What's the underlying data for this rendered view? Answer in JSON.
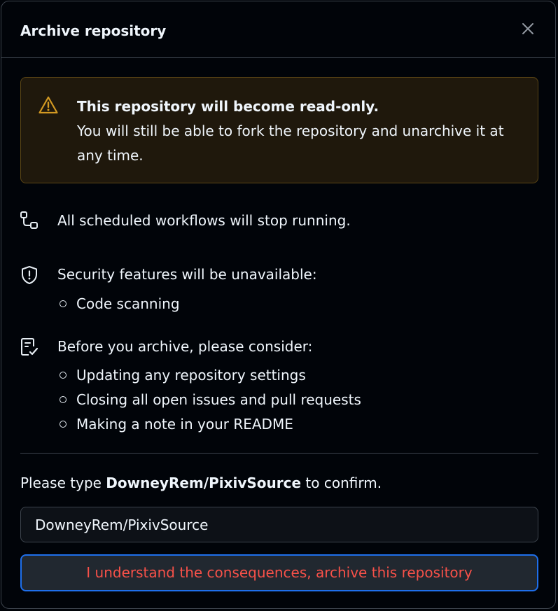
{
  "dialog": {
    "title": "Archive repository",
    "close_icon": "x-icon"
  },
  "warning": {
    "icon": "alert-icon",
    "title": "This repository will become read-only.",
    "body": "You will still be able to fork the repository and unarchive it at any time."
  },
  "workflows": {
    "icon": "workflow-icon",
    "text": "All scheduled workflows will stop running."
  },
  "security": {
    "icon": "shield-icon",
    "text": "Security features will be unavailable:",
    "items": [
      "Code scanning"
    ]
  },
  "consider": {
    "icon": "checklist-icon",
    "text": "Before you archive, please consider:",
    "items": [
      "Updating any repository settings",
      "Closing all open issues and pull requests",
      "Making a note in your README"
    ]
  },
  "confirm": {
    "prefix": "Please type ",
    "repo_name": "DowneyRem/PixivSource",
    "suffix": " to confirm.",
    "input_value": "DowneyRem/PixivSource",
    "button_label": "I understand the consequences, archive this repository"
  },
  "colors": {
    "background": "#010409",
    "warning_bg": "#1f180c",
    "warning_border": "#5c4615",
    "warning_icon": "#d29922",
    "danger_text": "#f85149",
    "focus_ring": "#1f6feb"
  }
}
